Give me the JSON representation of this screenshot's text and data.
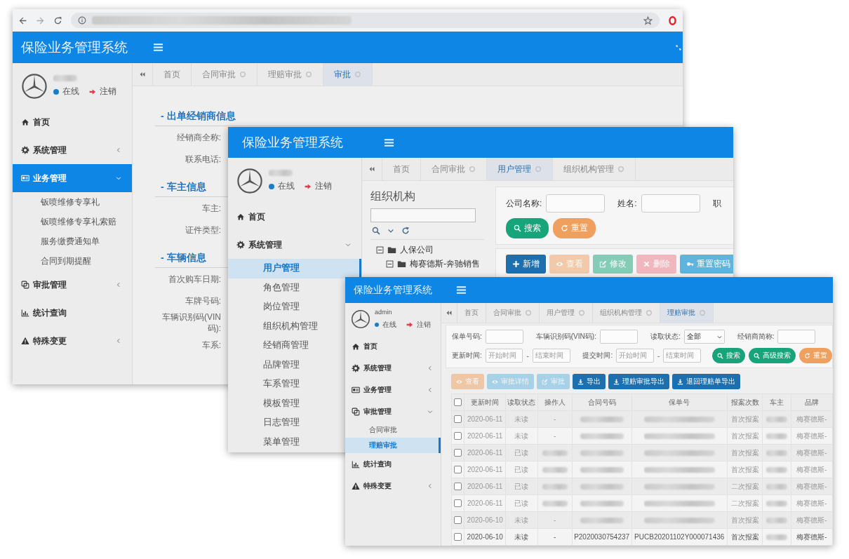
{
  "windows": [
    {
      "title": "保险业务管理系统",
      "user": {
        "status": "在线",
        "logout": "注销"
      },
      "menu": [
        {
          "label": "首页",
          "kind": "link",
          "selected": false
        },
        {
          "label": "系统管理",
          "kind": "group",
          "expanded": false,
          "selected": false
        },
        {
          "label": "业务管理",
          "kind": "group",
          "expanded": true,
          "selected": true,
          "children": [
            {
              "label": "钣喷维修专享礼",
              "selected": false
            },
            {
              "label": "钣喷维修专享礼索赔",
              "selected": false
            },
            {
              "label": "服务缴费通知单",
              "selected": false
            },
            {
              "label": "合同到期提醒",
              "selected": false
            }
          ]
        },
        {
          "label": "审批管理",
          "kind": "group",
          "expanded": false,
          "selected": false
        },
        {
          "label": "统计查询",
          "kind": "link",
          "selected": false
        },
        {
          "label": "特殊变更",
          "kind": "group",
          "expanded": false,
          "selected": false
        }
      ],
      "tabs": [
        {
          "label": "首页",
          "selected": false,
          "closable": false
        },
        {
          "label": "合同审批",
          "selected": false,
          "closable": true
        },
        {
          "label": "理赔审批",
          "selected": false,
          "closable": true
        },
        {
          "label": "审批",
          "selected": true,
          "closable": true
        }
      ],
      "form": [
        {
          "title": "- 出单经销商信息",
          "fields": [
            "经销商全称:",
            "联系电话:"
          ]
        },
        {
          "title": "- 车主信息",
          "fields": [
            "车主:",
            "证件类型:"
          ]
        },
        {
          "title": "- 车辆信息",
          "fields": [
            "首次购车日期:",
            "车牌号码:",
            "车辆识别码(VIN码):",
            "车系:"
          ]
        }
      ]
    },
    {
      "title": "保险业务管理系统",
      "user": {
        "status": "在线",
        "logout": "注销"
      },
      "menu": [
        {
          "label": "首页",
          "kind": "link",
          "selected": false
        },
        {
          "label": "系统管理",
          "kind": "group",
          "expanded": true,
          "selected": false,
          "children": [
            {
              "label": "用户管理",
              "selected": true
            },
            {
              "label": "角色管理",
              "selected": false
            },
            {
              "label": "岗位管理",
              "selected": false
            },
            {
              "label": "组织机构管理",
              "selected": false
            },
            {
              "label": "经销商管理",
              "selected": false
            },
            {
              "label": "品牌管理",
              "selected": false
            },
            {
              "label": "车系管理",
              "selected": false
            },
            {
              "label": "模板管理",
              "selected": false
            },
            {
              "label": "日志管理",
              "selected": false
            },
            {
              "label": "菜单管理",
              "selected": false
            }
          ]
        }
      ],
      "tabs": [
        {
          "label": "首页",
          "selected": false,
          "closable": false
        },
        {
          "label": "合同审批",
          "selected": false,
          "closable": true
        },
        {
          "label": "用户管理",
          "selected": true,
          "closable": true
        },
        {
          "label": "组织机构管理",
          "selected": false,
          "closable": true
        }
      ],
      "org_panel": {
        "title": "组织机构",
        "tree": [
          {
            "label": "人保公司",
            "expanded": true,
            "children": [
              {
                "label": "梅赛德斯-奔驰销售",
                "expanded": true
              }
            ]
          }
        ]
      },
      "filter": {
        "fields": [
          "公司名称:",
          "姓名:",
          "职"
        ],
        "buttons": [
          {
            "label": "搜索",
            "kind": "success"
          },
          {
            "label": "重置",
            "kind": "warning"
          }
        ]
      },
      "toolbar": [
        {
          "label": "新增",
          "kind": "primary",
          "disabled": false
        },
        {
          "label": "查看",
          "kind": "warning",
          "disabled": true
        },
        {
          "label": "修改",
          "kind": "success",
          "disabled": true
        },
        {
          "label": "删除",
          "kind": "danger",
          "disabled": true
        },
        {
          "label": "重置密码",
          "kind": "info",
          "disabled": false
        }
      ]
    },
    {
      "title": "保险业务管理系统",
      "user": {
        "name": "admin",
        "status": "在线",
        "logout": "注销"
      },
      "menu": [
        {
          "label": "首页",
          "kind": "link",
          "selected": false
        },
        {
          "label": "系统管理",
          "kind": "group",
          "expanded": false,
          "selected": false
        },
        {
          "label": "业务管理",
          "kind": "group",
          "expanded": false,
          "selected": false
        },
        {
          "label": "审批管理",
          "kind": "group",
          "expanded": true,
          "selected": false,
          "children": [
            {
              "label": "合同审批",
              "selected": false
            },
            {
              "label": "理赔审批",
              "selected": true
            }
          ]
        },
        {
          "label": "统计查询",
          "kind": "link",
          "selected": false
        },
        {
          "label": "特殊变更",
          "kind": "group",
          "expanded": false,
          "selected": false
        }
      ],
      "tabs": [
        {
          "label": "首页",
          "selected": false,
          "closable": false
        },
        {
          "label": "合同审批",
          "selected": false,
          "closable": true
        },
        {
          "label": "用户管理",
          "selected": false,
          "closable": true
        },
        {
          "label": "组织机构管理",
          "selected": false,
          "closable": true
        },
        {
          "label": "理赔审批",
          "selected": true,
          "closable": true
        }
      ],
      "filter": {
        "rows": [
          [
            {
              "label": "保单号码:",
              "kind": "input"
            },
            {
              "label": "车辆识别码(VIN码):",
              "kind": "input"
            },
            {
              "label": "读取状态:",
              "kind": "select",
              "value": "全部"
            },
            {
              "label": "经销商简称:",
              "kind": "input"
            }
          ],
          [
            {
              "label": "更新时间:",
              "kind": "range",
              "from": "开始时间",
              "separator": "-",
              "to": "结束时间"
            },
            {
              "label": "提交时间:",
              "kind": "range",
              "from": "开始时间",
              "separator": "-",
              "to": "结束时间"
            }
          ]
        ],
        "buttons": [
          {
            "label": "搜索",
            "kind": "success"
          },
          {
            "label": "高级搜索",
            "kind": "success"
          },
          {
            "label": "重置",
            "kind": "warning"
          }
        ]
      },
      "toolbar": [
        {
          "label": "查看",
          "kind": "warning",
          "disabled": true
        },
        {
          "label": "审批详情",
          "kind": "info",
          "disabled": true
        },
        {
          "label": "审批",
          "kind": "info",
          "disabled": true
        },
        {
          "label": "导出",
          "kind": "primary",
          "disabled": false
        },
        {
          "label": "理赔审批导出",
          "kind": "primary",
          "disabled": false
        },
        {
          "label": "退回理赔单导出",
          "kind": "primary",
          "disabled": false
        }
      ],
      "table": {
        "select_all_checked": false,
        "columns": [
          "更新时间",
          "读取状态",
          "操作人",
          "合同号码",
          "保单号",
          "报案次数",
          "车主",
          "品牌"
        ],
        "rows": [
          {
            "checked": false,
            "cells": [
              "2020-06-11",
              "未读",
              "-",
              null,
              null,
              "首次报案",
              null,
              "梅赛德斯-"
            ]
          },
          {
            "checked": false,
            "cells": [
              "2020-06-11",
              "未读",
              "-",
              null,
              null,
              "首次报案",
              null,
              "梅赛德斯-"
            ]
          },
          {
            "checked": false,
            "cells": [
              "2020-06-11",
              "已读",
              null,
              null,
              null,
              "首次报案",
              null,
              "梅赛德斯-"
            ]
          },
          {
            "checked": false,
            "cells": [
              "2020-06-11",
              "已读",
              null,
              null,
              null,
              "首次报案",
              null,
              "梅赛德斯-"
            ]
          },
          {
            "checked": false,
            "cells": [
              "2020-06-11",
              "已读",
              null,
              null,
              null,
              "二次报案",
              null,
              "梅赛德斯-"
            ]
          },
          {
            "checked": false,
            "cells": [
              "2020-06-11",
              "已读",
              null,
              null,
              null,
              "二次报案",
              null,
              "梅赛德斯-"
            ]
          },
          {
            "checked": false,
            "cells": [
              "2020-06-10",
              "未读",
              "-",
              null,
              null,
              "首次报案",
              null,
              "梅赛德斯-"
            ]
          },
          {
            "checked": false,
            "cells": [
              "2020-06-10",
              "未读",
              "-",
              "P2020030754237",
              "PUCB20201102Y000071436",
              "首次报案",
              null,
              "梅赛德斯-"
            ]
          }
        ]
      }
    }
  ]
}
